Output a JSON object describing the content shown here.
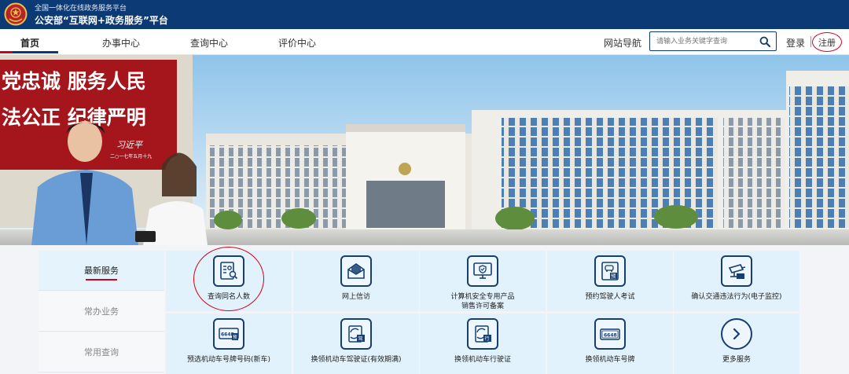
{
  "header": {
    "subtitle": "全国一体化在线政务服务平台",
    "title": "公安部“互联网+政务服务”平台"
  },
  "nav": {
    "items": [
      {
        "label": "首页",
        "active": true
      },
      {
        "label": "办事中心",
        "active": false
      },
      {
        "label": "查询中心",
        "active": false
      },
      {
        "label": "评价中心",
        "active": false
      }
    ],
    "site_nav": "网站导航",
    "search_placeholder": "请输入业务关键字查询",
    "login": "登录",
    "register": "注册"
  },
  "hero": {
    "wall_line1": "党忠诚  服务人民",
    "wall_line2": "法公正  纪律严明",
    "wall_signature": "习近平",
    "wall_date": "二○一七年五月十九"
  },
  "services": {
    "tabs": [
      {
        "label": "最新服务",
        "active": true
      },
      {
        "label": "常办业务",
        "active": false
      },
      {
        "label": "常用查询",
        "active": false
      }
    ],
    "items": [
      {
        "label": "查询同名人数",
        "icon": "id-card-search-icon"
      },
      {
        "label": "网上信访",
        "icon": "envelope-icon"
      },
      {
        "label": "计算机安全专用产品",
        "label2": "销售许可备案",
        "icon": "monitor-shield-icon"
      },
      {
        "label": "预约驾驶人考试",
        "icon": "driver-exam-icon"
      },
      {
        "label": "确认交通违法行为(电子监控)",
        "icon": "surveillance-camera-icon"
      },
      {
        "label": "预选机动车号牌号码(新车)",
        "icon": "license-plate-preselect-icon",
        "plate": "6648",
        "badge": "预"
      },
      {
        "label": "换领机动车驾驶证(有效期满)",
        "icon": "driver-license-renew-icon",
        "badge": "驾"
      },
      {
        "label": "换领机动车行驶证",
        "icon": "vehicle-license-renew-icon",
        "badge": "行"
      },
      {
        "label": "换领机动车号牌",
        "icon": "license-plate-icon",
        "plate": "6648"
      },
      {
        "label": "更多服务",
        "icon": "chevron-right-icon"
      }
    ]
  }
}
